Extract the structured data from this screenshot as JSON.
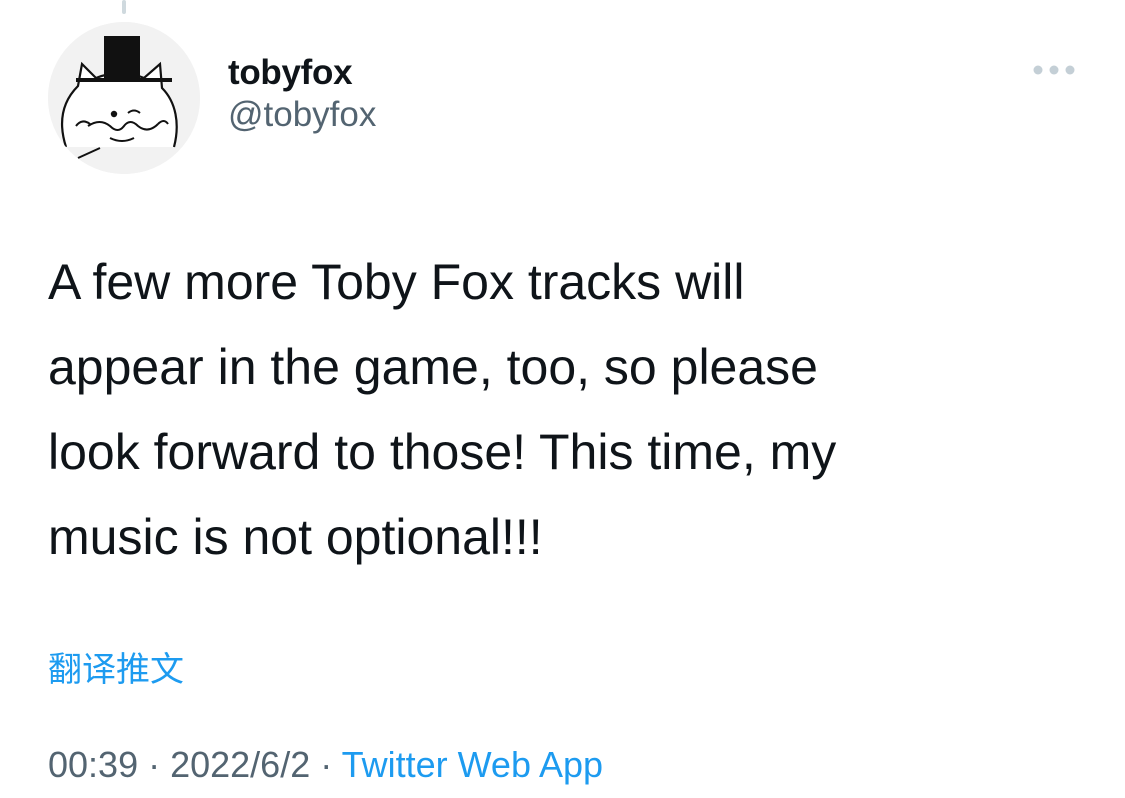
{
  "author": {
    "display_name": "tobyfox",
    "handle": "@tobyfox",
    "avatar_icon": "fox-with-top-hat-avatar"
  },
  "tweet": {
    "text": "A few more Toby Fox tracks will\nappear in the game, too, so please\nlook forward to those! This time, my\nmusic is not optional!!!",
    "translate_label": "翻译推文",
    "time": "00:39",
    "separator": " · ",
    "date": "2022/6/2",
    "source": "Twitter Web App"
  },
  "colors": {
    "link": "#1d9bf0",
    "secondary_text": "#536471",
    "primary_text": "#0f1419"
  }
}
